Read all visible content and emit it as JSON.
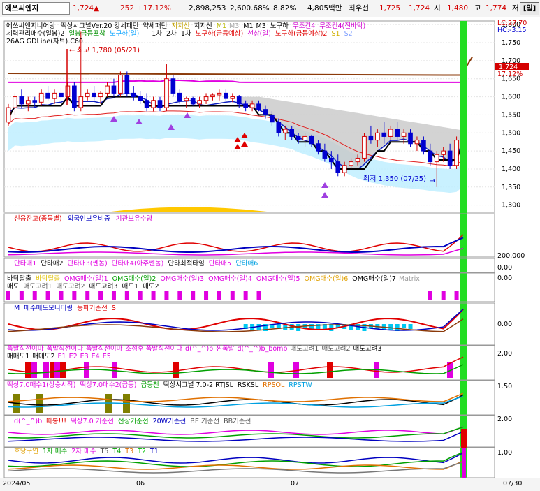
{
  "header": {
    "stock_name": "에쓰씨엔지",
    "price": "1,724",
    "change_arrow": "▲",
    "change": "252",
    "change_pct": "+17.12%",
    "volume": "2,898,253",
    "volume_pct": "2,600.68%",
    "turnover": "8.82%",
    "amount": "4,805백만",
    "best_ask_label": "최우선",
    "best_ask": "1,725",
    "best_bid": "1,724",
    "open_label": "시",
    "open": "1,480",
    "high_label": "고",
    "high": "1,774",
    "low_label": "저",
    "period_button": "[일]"
  },
  "colors": {
    "up": "#d40000",
    "down": "#0000d0",
    "magenta": "#e000e0",
    "brown": "#8b3a0a"
  },
  "price_panel": {
    "legend1": [
      "에쓰씨엔지니어링",
      "떡상시그널Ver.20 강세패턴",
      "약세패턴",
      "지지선",
      "지지선",
      "M1",
      "M3",
      "M1",
      "M3",
      "노구하",
      "무조건4",
      "무조건4(진바닥)"
    ],
    "legend2": [
      "세력관리매수(일봉)2",
      "일봉금등포착",
      "노구하(일)",
      "1차",
      "2차",
      "1차",
      "노구하(금등예상)",
      "선상(일)",
      "노구하(금등예상)2",
      "S1",
      "S2"
    ],
    "legend3": "26AG GDLine(차트)  C60",
    "high_note": "최고 1,780 (05/21)",
    "low_note": "최저 1,350 (07/25)",
    "ticks": [
      "1,800",
      "1,750",
      "1,700",
      "1,650",
      "1,600",
      "1,550",
      "1,500",
      "1,450",
      "1,400",
      "1,350",
      "1,300"
    ],
    "lc": "LC:27.70",
    "hc": "HC:-3.15",
    "cur_price_box": "1,724",
    "cur_pct_box": "17.12%"
  },
  "panel2": {
    "legend": [
      "신용잔고(종목별)",
      "외국인보유비중",
      "기관보유수량"
    ],
    "ticks": [
      "200,000",
      "0.00"
    ]
  },
  "panel3": {
    "legend": [
      "단타매1",
      "단타매2",
      "단타매3(쎈놈)",
      "단타매4(아주쎈놈)",
      "단타최적타임",
      "단타매5",
      "단타매6"
    ],
    "ticks": [
      "0.00"
    ]
  },
  "panel4": {
    "legend1": [
      "바닥탈출",
      "바닥탈출",
      "OMG매수(일)1",
      "OMG매수(일)2",
      "OMG매수(일)3",
      "OMG매수(일)4",
      "OMG매수(일)5",
      "OMG매수(일)6",
      "OMG매수(일)7",
      "Matrix"
    ],
    "legend2": [
      "매도",
      "매도고려1",
      "매도고려2",
      "매도고려3",
      "매도1",
      "매도2"
    ]
  },
  "panel5": {
    "legend": [
      "M",
      "매수매도모니터링",
      "동파기준선",
      "S"
    ],
    "ticks": [
      "0.00"
    ]
  },
  "panel6": {
    "legend1": [
      "폭발직전이마",
      "폭발직전이다",
      "폭발직전이마",
      "조정후 폭발직전이다",
      "d(^_^)b",
      "찐폭발",
      "d(^_^)b_bomb",
      "매도고려1",
      "매도고려2",
      "매도고려3"
    ],
    "legend2": [
      "매매도1",
      "매매도2",
      "E1",
      "E2",
      "E3",
      "E4",
      "E5"
    ],
    "ticks": [
      "2.00"
    ]
  },
  "panel7": {
    "legend": [
      "떡상7.0매수1(상승시작)",
      "떡상7.0매수2(급등)",
      "급등천",
      "떡상시그널 7.0-2 RTJSL",
      "RSKSL",
      "RPSOL",
      "RPSTW"
    ],
    "ticks": [
      "1.50"
    ]
  },
  "panel8": {
    "legend": [
      "d(^_^)b",
      "따봉!!!",
      "떡상7.0 기준선",
      "선상기준선",
      "20W기준선",
      "BE 기준선",
      "BB기준선"
    ],
    "ticks": [
      "2.00"
    ]
  },
  "panel9": {
    "legend": [
      "호당구연",
      "1차 매수",
      "2차 매수",
      "T5",
      "T4",
      "T3",
      "T2",
      "T1"
    ],
    "ticks": [
      "1.00"
    ]
  },
  "footer": {
    "dates": [
      "2024/05",
      "06",
      "07"
    ],
    "right_date": "07/30"
  },
  "chart_data": {
    "type": "candlestick",
    "ylim": [
      1280,
      1810
    ],
    "candles": [
      [
        1530,
        1580,
        1520,
        1570
      ],
      [
        1570,
        1610,
        1550,
        1600
      ],
      [
        1600,
        1620,
        1570,
        1580
      ],
      [
        1580,
        1600,
        1560,
        1590
      ],
      [
        1590,
        1600,
        1570,
        1585
      ],
      [
        1585,
        1620,
        1575,
        1610
      ],
      [
        1610,
        1630,
        1590,
        1595
      ],
      [
        1595,
        1620,
        1580,
        1610
      ],
      [
        1610,
        1625,
        1590,
        1600
      ],
      [
        1600,
        1640,
        1590,
        1630
      ],
      [
        1630,
        1640,
        1560,
        1570
      ],
      [
        1570,
        1780,
        1560,
        1600
      ],
      [
        1600,
        1620,
        1590,
        1610
      ],
      [
        1610,
        1630,
        1590,
        1600
      ],
      [
        1600,
        1615,
        1580,
        1610
      ],
      [
        1610,
        1640,
        1600,
        1630
      ],
      [
        1630,
        1650,
        1600,
        1610
      ],
      [
        1610,
        1670,
        1600,
        1660
      ],
      [
        1660,
        1670,
        1600,
        1610
      ],
      [
        1610,
        1630,
        1590,
        1600
      ],
      [
        1600,
        1615,
        1580,
        1590
      ],
      [
        1590,
        1610,
        1560,
        1570
      ],
      [
        1570,
        1600,
        1560,
        1590
      ],
      [
        1590,
        1600,
        1560,
        1570
      ],
      [
        1570,
        1690,
        1560,
        1650
      ],
      [
        1650,
        1660,
        1600,
        1610
      ],
      [
        1610,
        1620,
        1580,
        1590
      ],
      [
        1590,
        1600,
        1570,
        1595
      ],
      [
        1595,
        1600,
        1575,
        1580
      ],
      [
        1580,
        1600,
        1570,
        1590
      ],
      [
        1590,
        1610,
        1580,
        1600
      ],
      [
        1600,
        1610,
        1590,
        1605
      ],
      [
        1605,
        1620,
        1590,
        1610
      ],
      [
        1610,
        1620,
        1590,
        1595
      ],
      [
        1595,
        1610,
        1585,
        1600
      ],
      [
        1600,
        1605,
        1570,
        1580
      ],
      [
        1580,
        1590,
        1560,
        1570
      ],
      [
        1570,
        1590,
        1560,
        1580
      ],
      [
        1580,
        1590,
        1560,
        1565
      ],
      [
        1565,
        1575,
        1540,
        1550
      ],
      [
        1550,
        1560,
        1520,
        1530
      ],
      [
        1530,
        1540,
        1490,
        1500
      ],
      [
        1500,
        1520,
        1480,
        1510
      ],
      [
        1510,
        1520,
        1480,
        1490
      ],
      [
        1490,
        1500,
        1470,
        1480
      ],
      [
        1480,
        1500,
        1460,
        1490
      ],
      [
        1490,
        1495,
        1460,
        1470
      ],
      [
        1470,
        1480,
        1440,
        1450
      ],
      [
        1450,
        1470,
        1420,
        1430
      ],
      [
        1430,
        1450,
        1400,
        1420
      ],
      [
        1420,
        1440,
        1380,
        1390
      ],
      [
        1390,
        1420,
        1380,
        1410
      ],
      [
        1410,
        1430,
        1400,
        1420
      ],
      [
        1420,
        1440,
        1410,
        1430
      ],
      [
        1430,
        1500,
        1420,
        1490
      ],
      [
        1490,
        1520,
        1470,
        1480
      ],
      [
        1480,
        1510,
        1460,
        1500
      ],
      [
        1500,
        1530,
        1470,
        1490
      ],
      [
        1490,
        1520,
        1480,
        1510
      ],
      [
        1510,
        1530,
        1480,
        1490
      ],
      [
        1490,
        1510,
        1470,
        1500
      ],
      [
        1500,
        1510,
        1460,
        1470
      ],
      [
        1470,
        1490,
        1450,
        1480
      ],
      [
        1480,
        1490,
        1440,
        1450
      ],
      [
        1450,
        1470,
        1410,
        1420
      ],
      [
        1420,
        1450,
        1350,
        1440
      ],
      [
        1440,
        1460,
        1420,
        1450
      ],
      [
        1450,
        1470,
        1400,
        1410
      ],
      [
        1410,
        1490,
        1400,
        1480
      ],
      [
        1472,
        1774,
        1470,
        1724
      ]
    ]
  }
}
